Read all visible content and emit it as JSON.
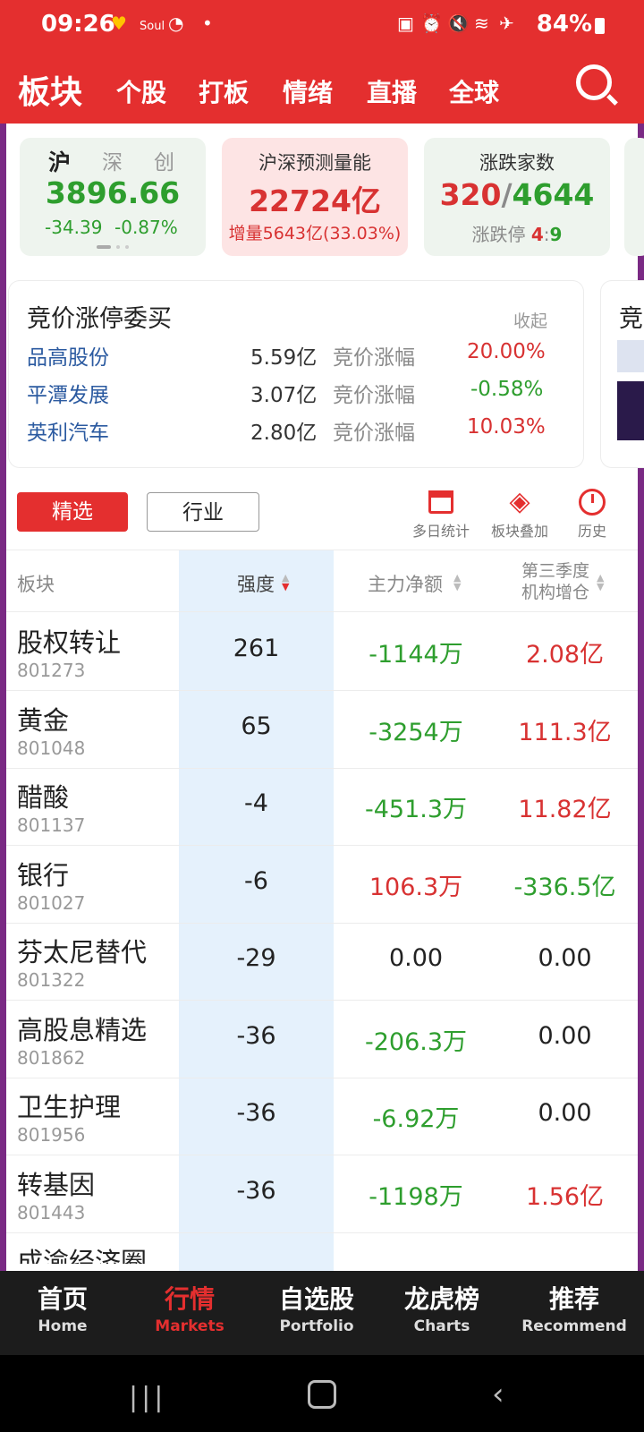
{
  "status": {
    "time": "09:26",
    "soul": "Soul",
    "battery": "84%"
  },
  "nav": {
    "tabs": [
      "板块",
      "个股",
      "打板",
      "情绪",
      "直播",
      "全球"
    ]
  },
  "cards": {
    "index": {
      "tabs": [
        "沪",
        "深",
        "创"
      ],
      "value": "3896.66",
      "change": "-34.39",
      "pct": "-0.87%"
    },
    "volume": {
      "title": "沪深预测量能",
      "value": "22724亿",
      "sub": "增量5643亿(33.03%)"
    },
    "updown": {
      "title": "涨跌家数",
      "up": "320",
      "sep": "/",
      "down": "4644",
      "limit_label": "涨跌停",
      "limit_up": "4",
      "limit_sep": ":",
      "limit_down": "9"
    }
  },
  "auction": {
    "title": "竞价涨停委买",
    "collapse": "收起",
    "peek_title": "竞",
    "rows": [
      {
        "name": "品高股份",
        "amount": "5.59亿",
        "label": "竞价涨幅",
        "pct": "20.00%",
        "color": "red"
      },
      {
        "name": "平潭发展",
        "amount": "3.07亿",
        "label": "竞价涨幅",
        "pct": "-0.58%",
        "color": "green"
      },
      {
        "name": "英利汽车",
        "amount": "2.80亿",
        "label": "竞价涨幅",
        "pct": "10.03%",
        "color": "red"
      }
    ]
  },
  "filters": {
    "selected": "精选",
    "industry": "行业"
  },
  "tools": {
    "multi_day": "多日统计",
    "overlay": "板块叠加",
    "history": "历史"
  },
  "table": {
    "headers": {
      "sector": "板块",
      "strength": "强度",
      "net": "主力净额",
      "q3_line1": "第三季度",
      "q3_line2": "机构增仓"
    },
    "rows": [
      {
        "name": "股权转让",
        "code": "801273",
        "strength": "261",
        "net": "-1144万",
        "net_color": "green",
        "inst": "2.08亿",
        "inst_color": "red"
      },
      {
        "name": "黄金",
        "code": "801048",
        "strength": "65",
        "net": "-3254万",
        "net_color": "green",
        "inst": "111.3亿",
        "inst_color": "red"
      },
      {
        "name": "醋酸",
        "code": "801137",
        "strength": "-4",
        "net": "-451.3万",
        "net_color": "green",
        "inst": "11.82亿",
        "inst_color": "red"
      },
      {
        "name": "银行",
        "code": "801027",
        "strength": "-6",
        "net": "106.3万",
        "net_color": "red",
        "inst": "-336.5亿",
        "inst_color": "green"
      },
      {
        "name": "芬太尼替代",
        "code": "801322",
        "strength": "-29",
        "net": "0.00",
        "net_color": "black",
        "inst": "0.00",
        "inst_color": "black"
      },
      {
        "name": "高股息精选",
        "code": "801862",
        "strength": "-36",
        "net": "-206.3万",
        "net_color": "green",
        "inst": "0.00",
        "inst_color": "black"
      },
      {
        "name": "卫生护理",
        "code": "801956",
        "strength": "-36",
        "net": "-6.92万",
        "net_color": "green",
        "inst": "0.00",
        "inst_color": "black"
      },
      {
        "name": "转基因",
        "code": "801443",
        "strength": "-36",
        "net": "-1198万",
        "net_color": "green",
        "inst": "1.56亿",
        "inst_color": "red"
      },
      {
        "name": "成渝经济圈",
        "code": "",
        "strength": "",
        "net": "",
        "net_color": "green",
        "inst": "",
        "inst_color": "green"
      }
    ]
  },
  "bottom_nav": [
    {
      "zh": "首页",
      "en": "Home"
    },
    {
      "zh": "行情",
      "en": "Markets"
    },
    {
      "zh": "自选股",
      "en": "Portfolio"
    },
    {
      "zh": "龙虎榜",
      "en": "Charts"
    },
    {
      "zh": "推荐",
      "en": "Recommend"
    }
  ]
}
